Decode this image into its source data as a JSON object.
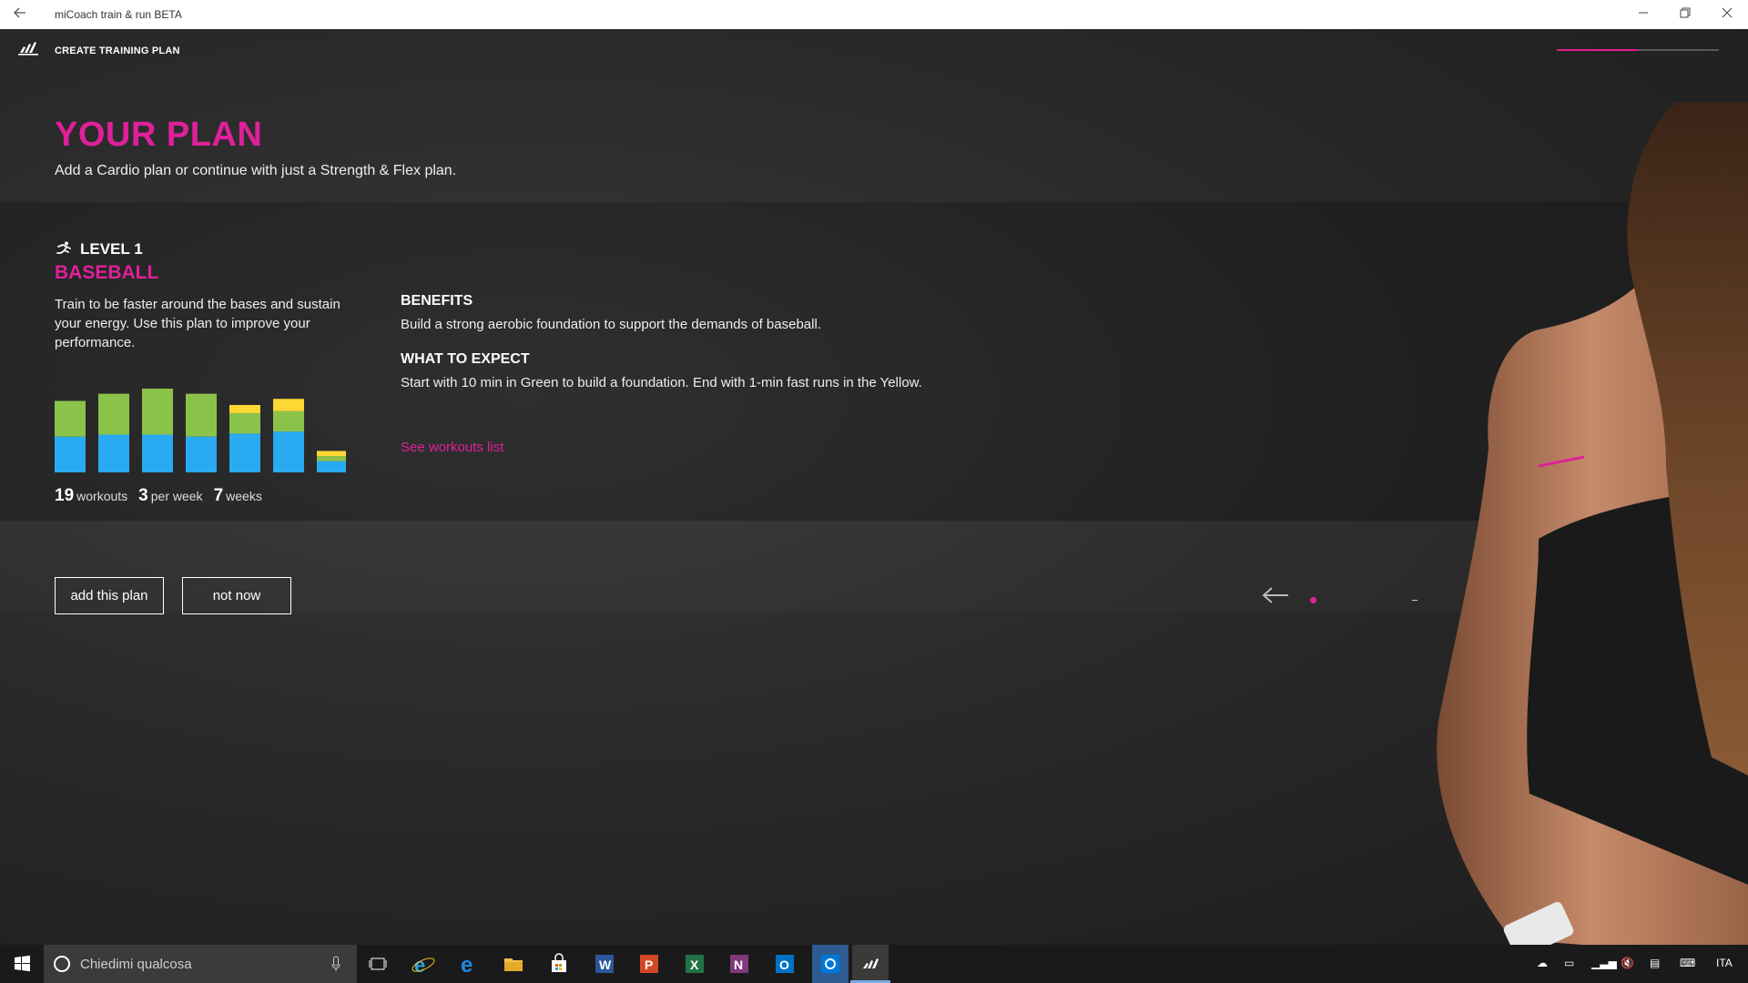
{
  "window": {
    "title": "miCoach train & run BETA",
    "back_icon": "back-arrow-icon",
    "controls": [
      "minimize-icon",
      "restore-icon",
      "close-icon"
    ]
  },
  "header": {
    "brand": "adidas",
    "breadcrumb": "CREATE TRAINING PLAN",
    "progress_fraction": 0.5
  },
  "page": {
    "title": "YOUR PLAN",
    "subtitle": "Add a Cardio plan or continue with just a Strength & Flex plan."
  },
  "plan": {
    "level": "LEVEL 1",
    "sport": "BASEBALL",
    "description": "Train to be faster around the bases and sustain your energy. Use this plan to improve your performance.",
    "stats": [
      {
        "value": "19",
        "label": "workouts"
      },
      {
        "value": "3",
        "label": "per week"
      },
      {
        "value": "7",
        "label": "weeks"
      }
    ],
    "benefits_heading": "BENEFITS",
    "benefits_text": "Build a strong aerobic foundation to support the demands of baseball.",
    "expect_heading": "WHAT TO EXPECT",
    "expect_text": "Start with 10 min in Green to build a foundation. End with 1-min fast runs in the Yellow.",
    "workouts_link": "See workouts list"
  },
  "chart_data": {
    "type": "bar",
    "stacked": true,
    "categories": [
      "1",
      "2",
      "3",
      "4",
      "5",
      "6",
      "7"
    ],
    "series": [
      {
        "color": "#2aaaf0",
        "values": [
          35,
          37,
          37,
          35,
          38,
          40,
          11
        ]
      },
      {
        "color": "#8bc34a",
        "values": [
          35,
          40,
          45,
          42,
          20,
          20,
          5
        ]
      },
      {
        "color": "#fdd835",
        "values": [
          0,
          0,
          0,
          0,
          8,
          12,
          5
        ]
      }
    ],
    "ylim": [
      0,
      82
    ]
  },
  "actions": {
    "add": "add this plan",
    "skip": "not now"
  },
  "carousel": {
    "prev_icon": "arrow-left-icon",
    "active_index": 0
  },
  "colors": {
    "accent": "#e0209a",
    "blue": "#2aaaf0",
    "green": "#8bc34a",
    "yellow": "#fdd835"
  },
  "taskbar": {
    "search_placeholder": "Chiedimi qualcosa",
    "apps": [
      "task-view-icon",
      "internet-explorer-icon",
      "edge-icon",
      "file-explorer-icon",
      "store-icon",
      "word-icon",
      "powerpoint-icon",
      "excel-icon",
      "onenote-icon",
      "outlook-icon",
      "settings-icon",
      "adidas-app-icon"
    ],
    "language": "ITA"
  }
}
